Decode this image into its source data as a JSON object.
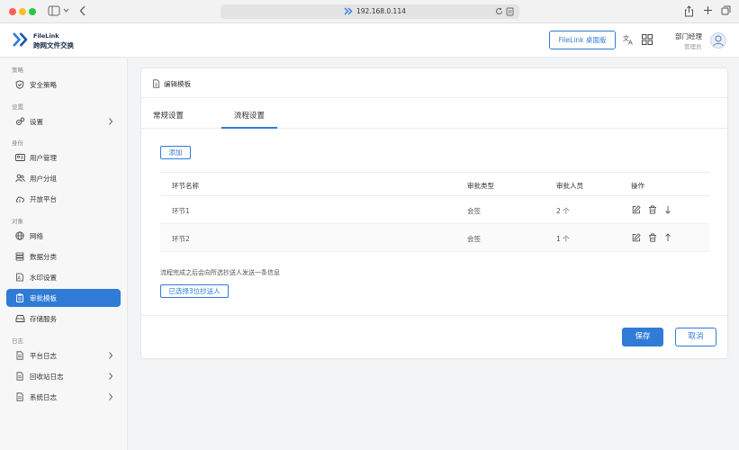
{
  "browser": {
    "address": "192.168.0.114"
  },
  "header": {
    "brand_en": "FileLink",
    "brand_cn": "跨网文件交换",
    "desktop_button": "FileLink 桌面版",
    "user_name": "部门经理",
    "user_role": "管理员"
  },
  "sidebar": {
    "sections": {
      "strategy": "策略",
      "settings": "设置",
      "identity": "身份",
      "objects": "对象",
      "logs": "日志"
    },
    "items": {
      "security": "安全策略",
      "settings": "设置",
      "users": "用户管理",
      "groups": "用户分组",
      "open": "开放平台",
      "network": "网络",
      "dataclass": "数据分类",
      "watermark": "水印设置",
      "approval": "审批模板",
      "storage": "存储服务",
      "platformlog": "平台日志",
      "recyclelog": "回收站日志",
      "systemlog": "系统日志"
    }
  },
  "main": {
    "title": "编辑模板",
    "tabs": [
      "常规设置",
      "流程设置"
    ],
    "active_tab": "流程设置",
    "add_button": "添加",
    "columns": [
      "环节名称",
      "审批类型",
      "审批人员",
      "操作"
    ],
    "rows": [
      {
        "name": "环节1",
        "type": "会签",
        "count": "2 个"
      },
      {
        "name": "环节2",
        "type": "会签",
        "count": "1 个"
      }
    ],
    "note": "流程完成之后会向所选抄送人发送一条信息",
    "cc_button": "已选择3位抄送人",
    "save": "保存",
    "cancel": "取消"
  },
  "colors": {
    "accent": "#2f7bd6",
    "sidebar_bg": "#f7f7f8"
  }
}
